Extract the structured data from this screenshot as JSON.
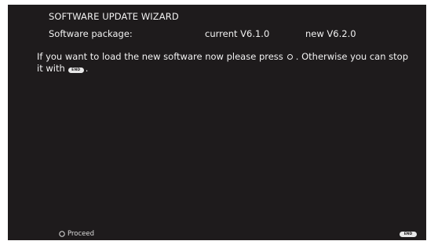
{
  "wizard": {
    "title": "SOFTWARE UPDATE WIZARD",
    "package_label": "Software package:",
    "current_version": "current V6.1.0",
    "new_version": "new V6.2.0"
  },
  "message": {
    "part1": "If you want to load the new software now please press",
    "part2": ". Otherwise you can stop it with",
    "part3": "."
  },
  "keys": {
    "end_label": "END",
    "ok_icon": "ok-key-icon",
    "end_icon": "end-key-icon"
  },
  "footer": {
    "proceed_label": "Proceed",
    "end_label": "END"
  },
  "colors": {
    "screen_background": "#1e1b1c",
    "text": "#f2f2f2",
    "key_pill": "#e8e8e8"
  }
}
